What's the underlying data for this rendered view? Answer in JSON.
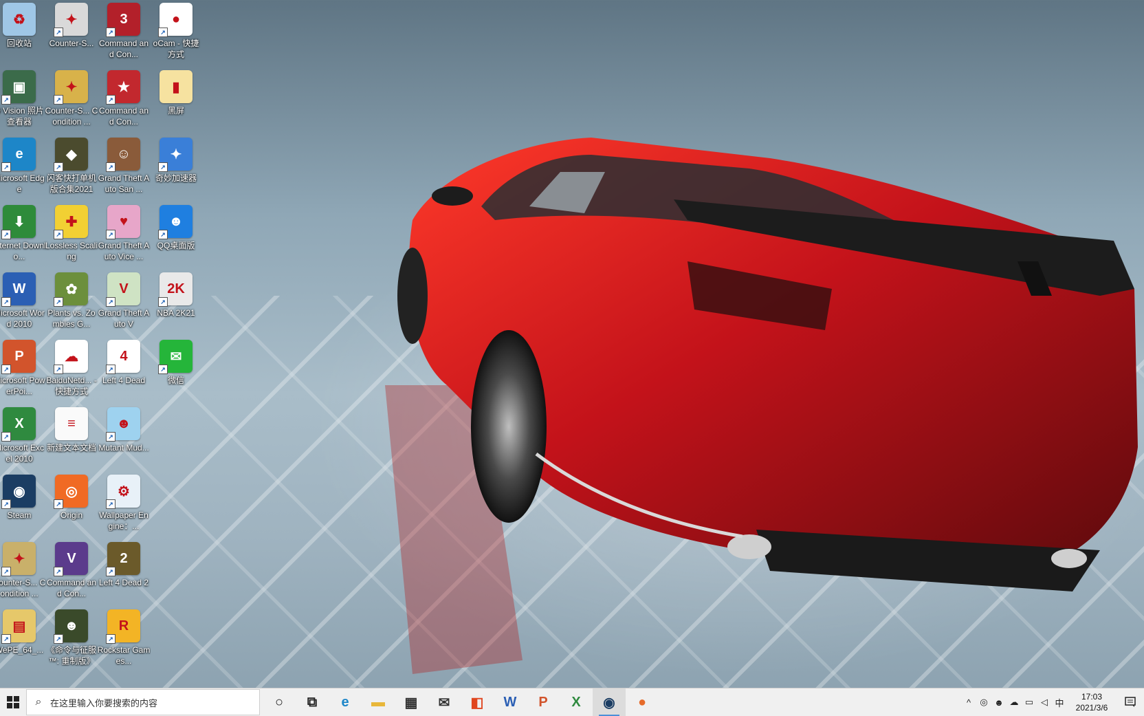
{
  "desktop": {
    "icons": [
      {
        "label": "回收站",
        "icon": "recycle-bin-icon",
        "color": "#9fc7e6",
        "glyph": "♻",
        "shortcut": false
      },
      {
        "label": "D Vision 照片查看器",
        "icon": "photo-viewer-icon",
        "color": "#3b6b4a",
        "glyph": "▣",
        "shortcut": true
      },
      {
        "label": "Microsoft Edge",
        "icon": "edge-icon",
        "color": "#1d86c8",
        "glyph": "e",
        "shortcut": true
      },
      {
        "label": "Internet Downlo...",
        "icon": "idm-icon",
        "color": "#2e8b3a",
        "glyph": "⬇",
        "shortcut": true
      },
      {
        "label": "Microsoft Word 2010",
        "icon": "word-icon",
        "color": "#2b5fb4",
        "glyph": "W",
        "shortcut": true
      },
      {
        "label": "Microsoft PowerPoi...",
        "icon": "powerpoint-icon",
        "color": "#d2542c",
        "glyph": "P",
        "shortcut": true
      },
      {
        "label": "Microsoft Excel 2010",
        "icon": "excel-icon",
        "color": "#2f8a3f",
        "glyph": "X",
        "shortcut": true
      },
      {
        "label": "Steam",
        "icon": "steam-icon",
        "color": "#1b3d63",
        "glyph": "◉",
        "shortcut": true
      },
      {
        "label": "Counter-S... Condition ...",
        "icon": "counter-strike-icon",
        "color": "#c9b06a",
        "glyph": "✦",
        "shortcut": true
      },
      {
        "label": "WePE_64_...",
        "icon": "wepe-icon",
        "color": "#e6c86a",
        "glyph": "▤",
        "shortcut": true
      },
      {
        "label": "Counter-S...",
        "icon": "counter-strike-icon",
        "color": "#d9d9d9",
        "glyph": "✦",
        "shortcut": true
      },
      {
        "label": "Counter-S... Condition ...",
        "icon": "counter-strike-cz-icon",
        "color": "#d8b24a",
        "glyph": "✦",
        "shortcut": true
      },
      {
        "label": "闪客快打单机版合集2021",
        "icon": "flash-game-icon",
        "color": "#4b4b2e",
        "glyph": "◆",
        "shortcut": true
      },
      {
        "label": "Lossless Scaling",
        "icon": "lossless-scaling-icon",
        "color": "#f2d033",
        "glyph": "✚",
        "shortcut": true
      },
      {
        "label": "Plants vs. Zombies G...",
        "icon": "plants-vs-zombies-icon",
        "color": "#6c8f3c",
        "glyph": "✿",
        "shortcut": true
      },
      {
        "label": "BaiduNetd... - 快捷方式",
        "icon": "baidu-netdisk-icon",
        "color": "#ffffff",
        "glyph": "☁",
        "shortcut": true
      },
      {
        "label": "新建文本文档",
        "icon": "text-document-icon",
        "color": "#fafafa",
        "glyph": "≡",
        "shortcut": false
      },
      {
        "label": "Origin",
        "icon": "origin-icon",
        "color": "#f06a24",
        "glyph": "◎",
        "shortcut": true
      },
      {
        "label": "Command and Con...",
        "icon": "command-conquer-icon",
        "color": "#5b3b8c",
        "glyph": "V",
        "shortcut": true
      },
      {
        "label": "《命令与征服™: 重制版》",
        "icon": "command-conquer-remastered-icon",
        "color": "#3a4a2a",
        "glyph": "☻",
        "shortcut": true
      },
      {
        "label": "Command and Con...",
        "icon": "command-conquer-3-icon",
        "color": "#b3202a",
        "glyph": "3",
        "shortcut": true
      },
      {
        "label": "Command and Con...",
        "icon": "red-alert-icon",
        "color": "#c2282e",
        "glyph": "★",
        "shortcut": true
      },
      {
        "label": "Grand Theft Auto San ...",
        "icon": "gta-san-andreas-icon",
        "color": "#8a5b3a",
        "glyph": "☺",
        "shortcut": true
      },
      {
        "label": "Grand Theft Auto Vice ...",
        "icon": "gta-vice-city-icon",
        "color": "#e7a6c9",
        "glyph": "♥",
        "shortcut": true
      },
      {
        "label": "Grand Theft Auto V",
        "icon": "gta-v-icon",
        "color": "#cfe3c4",
        "glyph": "V",
        "shortcut": true
      },
      {
        "label": "Left 4 Dead",
        "icon": "left-4-dead-icon",
        "color": "#ffffff",
        "glyph": "4",
        "shortcut": true
      },
      {
        "label": "Mutant Mud...",
        "icon": "mutant-mudds-icon",
        "color": "#9ed2ef",
        "glyph": "☻",
        "shortcut": true
      },
      {
        "label": "Wallpaper Engine：...",
        "icon": "wallpaper-engine-icon",
        "color": "#e8f1f8",
        "glyph": "⚙",
        "shortcut": true
      },
      {
        "label": "Left 4 Dead 2",
        "icon": "left-4-dead-2-icon",
        "color": "#6b5a2a",
        "glyph": "2",
        "shortcut": true
      },
      {
        "label": "Rockstar Games...",
        "icon": "rockstar-icon",
        "color": "#f3b425",
        "glyph": "R",
        "shortcut": true
      },
      {
        "label": "oCam - 快捷方式",
        "icon": "ocam-icon",
        "color": "#ffffff",
        "glyph": "●",
        "shortcut": true
      },
      {
        "label": "黑屏",
        "icon": "folder-icon",
        "color": "#f6e2a0",
        "glyph": "▮",
        "shortcut": false
      },
      {
        "label": "奇妙加速器",
        "icon": "accelerator-icon",
        "color": "#3a7fd8",
        "glyph": "✦",
        "shortcut": true
      },
      {
        "label": "QQ桌面版",
        "icon": "qq-icon",
        "color": "#1f7fe0",
        "glyph": "☻",
        "shortcut": true
      },
      {
        "label": "NBA 2K21",
        "icon": "nba-2k21-icon",
        "color": "#e9e9e9",
        "glyph": "2K",
        "shortcut": true
      },
      {
        "label": "微信",
        "icon": "wechat-icon",
        "color": "#25b53a",
        "glyph": "✉",
        "shortcut": true
      }
    ]
  },
  "taskbar": {
    "search_placeholder": "在这里输入你要搜索的内容",
    "apps": [
      {
        "name": "cortana",
        "icon": "cortana-circle-icon",
        "glyph": "○",
        "color": "#222",
        "active": false
      },
      {
        "name": "task-view",
        "icon": "task-view-icon",
        "glyph": "⧉",
        "color": "#222",
        "active": false
      },
      {
        "name": "edge",
        "icon": "edge-icon",
        "glyph": "e",
        "color": "#1d86c8",
        "active": false
      },
      {
        "name": "file-explorer",
        "icon": "folder-icon",
        "glyph": "▬",
        "color": "#e8b73a",
        "active": false
      },
      {
        "name": "store",
        "icon": "store-bag-icon",
        "glyph": "▦",
        "color": "#333",
        "active": false
      },
      {
        "name": "mail",
        "icon": "mail-icon",
        "glyph": "✉",
        "color": "#333",
        "active": false
      },
      {
        "name": "office",
        "icon": "office-icon",
        "glyph": "◧",
        "color": "#e0461f",
        "active": false
      },
      {
        "name": "word",
        "icon": "word-icon",
        "glyph": "W",
        "color": "#2b5fb4",
        "active": false
      },
      {
        "name": "powerpoint",
        "icon": "powerpoint-icon",
        "glyph": "P",
        "color": "#d2542c",
        "active": false
      },
      {
        "name": "excel",
        "icon": "excel-icon",
        "glyph": "X",
        "color": "#2f8a3f",
        "active": false
      },
      {
        "name": "steam",
        "icon": "steam-icon",
        "glyph": "◉",
        "color": "#1b3d63",
        "active": true
      },
      {
        "name": "ocam",
        "icon": "ocam-icon",
        "glyph": "●",
        "color": "#e66b2a",
        "active": false
      }
    ],
    "tray": [
      {
        "name": "show-hidden",
        "icon": "chevron-up-icon",
        "glyph": "^"
      },
      {
        "name": "ocam-tray",
        "icon": "record-icon",
        "glyph": "◎"
      },
      {
        "name": "qq-tray",
        "icon": "qq-icon",
        "glyph": "☻"
      },
      {
        "name": "onedrive",
        "icon": "cloud-icon",
        "glyph": "☁"
      },
      {
        "name": "network",
        "icon": "network-icon",
        "glyph": "▭"
      },
      {
        "name": "volume",
        "icon": "speaker-icon",
        "glyph": "◁"
      },
      {
        "name": "ime",
        "icon": "ime-indicator",
        "glyph": "中"
      }
    ],
    "clock": {
      "time": "17:03",
      "date": "2021/3/6"
    }
  },
  "colors": {
    "taskbar": "#f0f0f0",
    "accent": "#4a8fd8",
    "car": "#c3121a"
  }
}
